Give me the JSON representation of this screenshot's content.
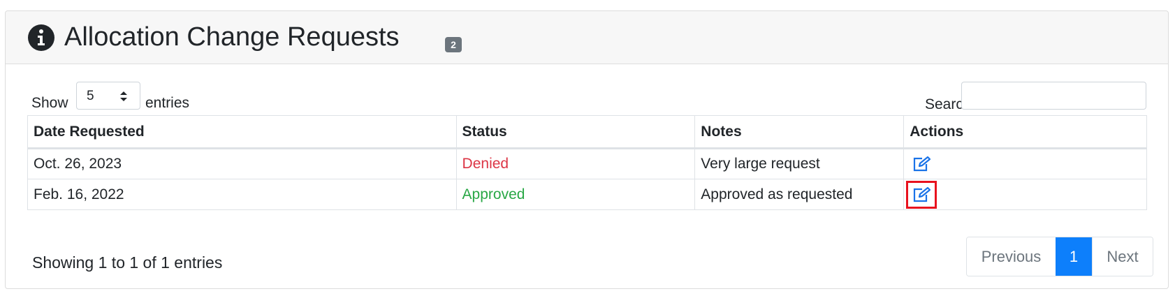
{
  "header": {
    "title": "Allocation Change Requests",
    "count_badge": "2",
    "icon": "info-circle-icon"
  },
  "controls": {
    "show_label": "Show",
    "entries_label": "entries",
    "page_length_value": "5",
    "search_label": "Search:",
    "search_value": ""
  },
  "table": {
    "columns": [
      "Date Requested",
      "Status",
      "Notes",
      "Actions"
    ],
    "rows": [
      {
        "date": "Oct. 26, 2023",
        "status": "Denied",
        "notes": "Very large request",
        "action_icon": "edit-icon"
      },
      {
        "date": "Feb. 16, 2022",
        "status": "Approved",
        "notes": "Approved as requested",
        "action_icon": "edit-icon"
      }
    ]
  },
  "footer": {
    "info": "Showing 1 to 1 of 1 entries",
    "pagination": {
      "previous": "Previous",
      "current_page": "1",
      "next": "Next"
    }
  },
  "colors": {
    "denied": "#dc3545",
    "approved": "#28a745",
    "accent": "#0d7ffb",
    "edit_icon": "#1a73e8",
    "highlight": "#e8121e"
  }
}
